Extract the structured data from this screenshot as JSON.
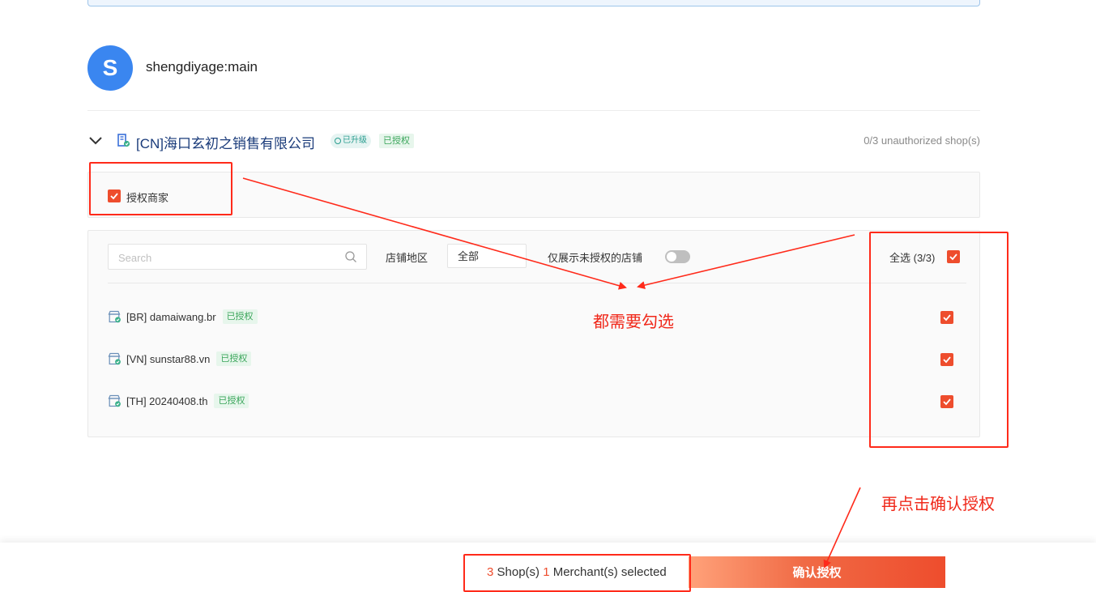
{
  "account": {
    "avatar_letter": "S",
    "avatar_color": "#3a86f0",
    "name": "shengdiyage:main"
  },
  "merchant": {
    "company_name": "[CN]海口玄初之销售有限公司",
    "upgraded_badge": "已升级",
    "authorized_badge": "已授权",
    "unauthorized_count": "0/3 unauthorized shop(s)",
    "authorize_label": "授权商家",
    "authorize_checked": true
  },
  "filters": {
    "search_placeholder": "Search",
    "region_label": "店铺地区",
    "region_value": "全部",
    "unauthorized_only_label": "仅展示未授权的店铺",
    "unauthorized_only_on": false,
    "select_all_label": "全选 (3/3)",
    "select_all_checked": true
  },
  "shops": [
    {
      "name": "[BR] damaiwang.br",
      "status": "已授权",
      "checked": true
    },
    {
      "name": "[VN] sunstar88.vn",
      "status": "已授权",
      "checked": true
    },
    {
      "name": "[TH] 20240408.th",
      "status": "已授权",
      "checked": true
    }
  ],
  "annotations": {
    "check_all": "都需要勾选",
    "then_confirm": "再点击确认授权"
  },
  "footer": {
    "shop_count": "3",
    "shop_label": " Shop(s) ",
    "merchant_count": "1",
    "merchant_label": " Merchant(s) selected",
    "confirm_label": "确认授权"
  },
  "colors": {
    "accent": "#ee4d2d",
    "annotation": "#ff2a1a",
    "link_blue": "#1a3b7a",
    "authorized_green": "#3aa55a"
  }
}
